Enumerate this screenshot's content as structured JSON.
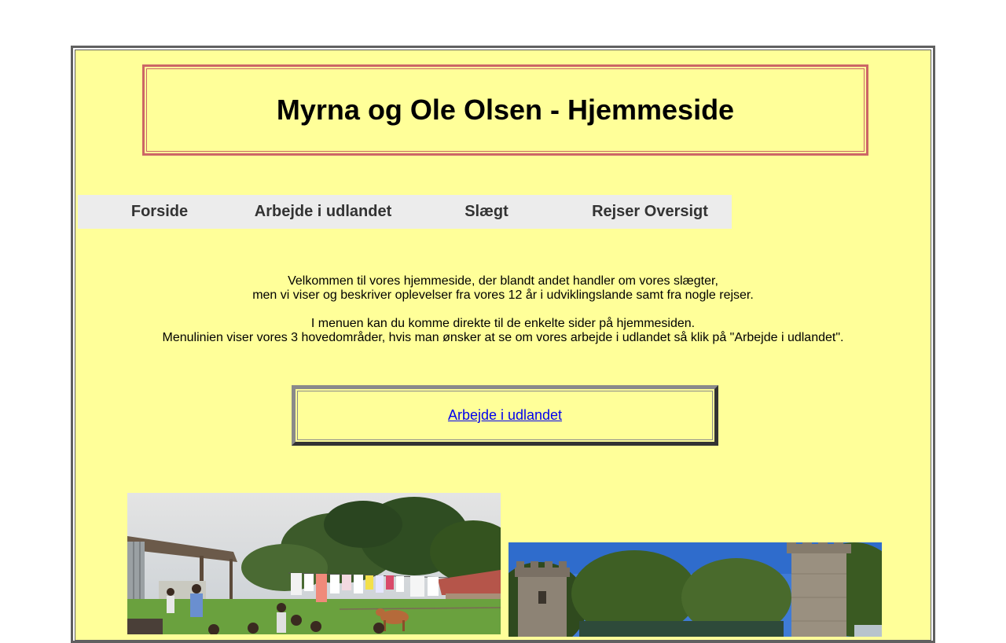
{
  "header": {
    "title": "Myrna og Ole Olsen - Hjemmeside"
  },
  "nav": {
    "items": [
      {
        "label": "Forside"
      },
      {
        "label": "Arbejde i udlandet"
      },
      {
        "label": "Slægt"
      },
      {
        "label": "Rejser Oversigt"
      }
    ]
  },
  "intro": {
    "line1": "Velkommen til vores hjemmeside, der blandt andet handler om vores slægter,",
    "line2": "men vi viser og beskriver oplevelser fra vores 12 år i udviklingslande samt fra nogle rejser.",
    "line3": "I menuen kan du komme direkte til de enkelte sider på hjemmesiden.",
    "line4": "Menulinien viser vores 3 hovedområder, hvis man ønsker at se om vores arbejde i udlandet så klik på \"Arbejde i udlandet\"."
  },
  "featured_link": {
    "label": "Arbejde i udlandet"
  },
  "colors": {
    "page_background": "#ffff99",
    "title_border": "#cc6666",
    "nav_background": "#ececec",
    "link": "#0000ee"
  }
}
